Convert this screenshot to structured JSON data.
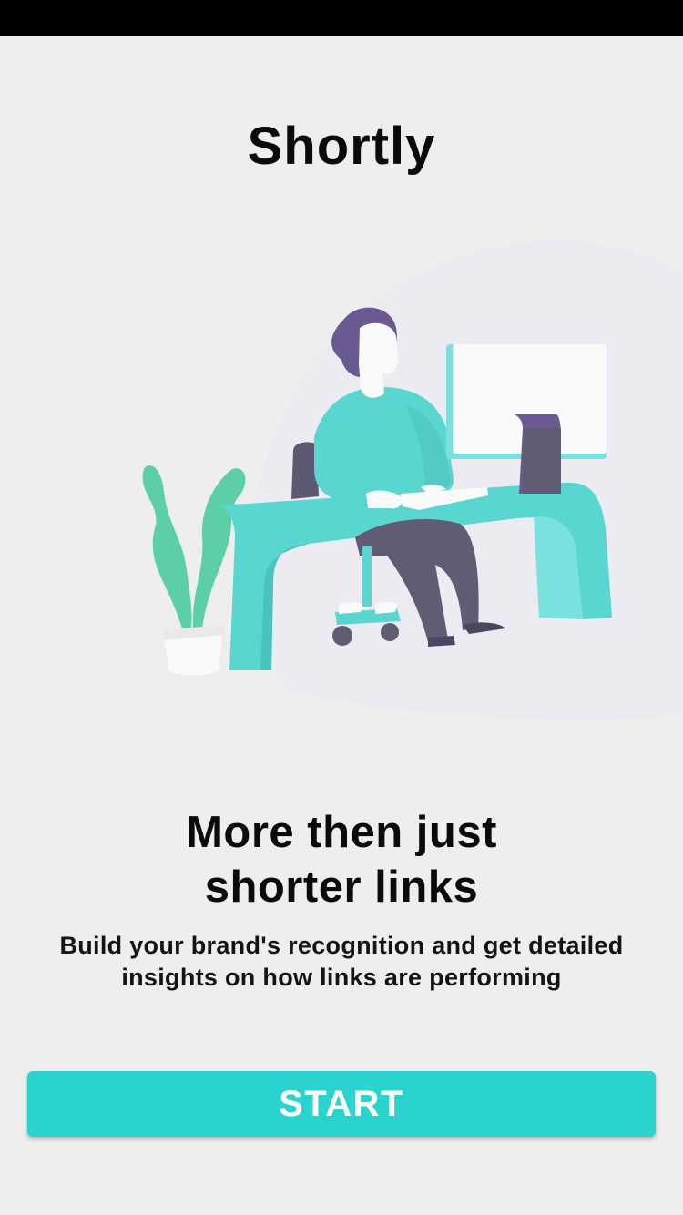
{
  "app": {
    "title": "Shortly"
  },
  "onboarding": {
    "headline_line1": "More then just",
    "headline_line2": "shorter links",
    "description_line1": "Build your brand's recognition and get detailed",
    "description_line2": "insights on how links are performing",
    "start_label": "START"
  },
  "illustration": {
    "name": "person-working-at-desk-illustration"
  },
  "colors": {
    "background": "#eeeeee",
    "accent": "#2bd3cf",
    "title_text": "#0b0b0b",
    "button_text": "#ffffff",
    "status_bar": "#000000"
  }
}
